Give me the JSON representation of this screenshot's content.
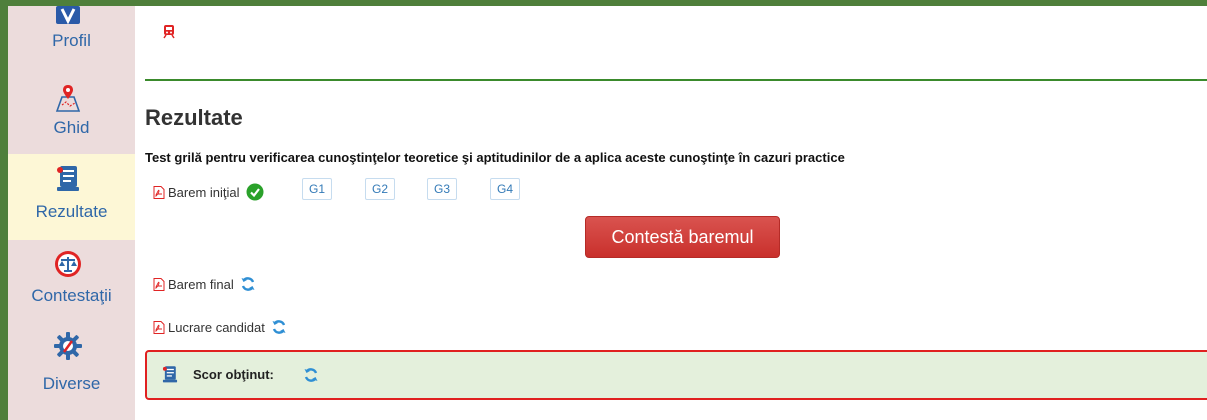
{
  "sidebar": {
    "items": [
      {
        "label": "Profil",
        "icon": "profile-icon"
      },
      {
        "label": "Ghid",
        "icon": "map-pin-icon"
      },
      {
        "label": "Rezultate",
        "icon": "results-icon"
      },
      {
        "label": "Contestaţii",
        "icon": "scales-icon"
      },
      {
        "label": "Diverse",
        "icon": "gear-icon"
      }
    ]
  },
  "main": {
    "title": "Rezultate",
    "subtitle": "Test grilă pentru verificarea cunoştinţelor teoretice şi aptitudinilor de a aplica aceste cunoştinţe în cazuri practice",
    "barem_initial_label": "Barem iniţial",
    "groups": [
      "G1",
      "G2",
      "G3",
      "G4"
    ],
    "contest_button": "Contestă baremul",
    "barem_final_label": "Barem final",
    "lucrare_label": "Lucrare candidat",
    "score_label": "Scor obţinut:"
  },
  "colors": {
    "frame": "#4f7f3b",
    "sidebar_bg": "#ecdcdc",
    "active_bg": "#fdf7d6",
    "link": "#2f67a8",
    "danger": "#d9534f",
    "success_bg": "#e4f0dc"
  }
}
